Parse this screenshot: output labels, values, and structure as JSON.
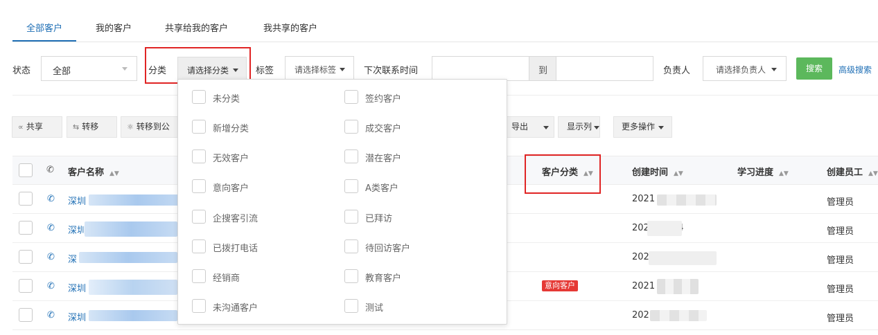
{
  "tabs": [
    "全部客户",
    "我的客户",
    "共享给我的客户",
    "我共享的客户"
  ],
  "filters": {
    "status_label": "状态",
    "status_value": "全部",
    "category_label": "分类",
    "category_placeholder": "请选择分类",
    "tag_label": "标签",
    "tag_placeholder": "请选择标签",
    "next_contact_label": "下次联系时间",
    "to_label": "到",
    "owner_label": "负责人",
    "owner_placeholder": "请选择负责人",
    "search_button": "搜索",
    "advanced_search": "高级搜索"
  },
  "actions": {
    "share": "共享",
    "transfer": "转移",
    "transfer_public": "转移到公",
    "export": "导出",
    "show_columns": "显示列",
    "more_actions": "更多操作"
  },
  "table": {
    "headers": {
      "name": "客户名称",
      "category": "客户分类",
      "created_time": "创建时间",
      "progress": "学习进度",
      "creator": "创建员工"
    },
    "rows": [
      {
        "name": "深圳",
        "time": "2021",
        "creator": "管理员",
        "badge": ""
      },
      {
        "name": "深圳",
        "time": "2021      15 04",
        "creator": "管理员",
        "badge": ""
      },
      {
        "name": "深",
        "time": "202",
        "creator": "管理员",
        "badge": ""
      },
      {
        "name": "深圳",
        "time": "2021        04",
        "creator": "管理员",
        "badge": "意向客户"
      },
      {
        "name": "深圳",
        "time": "202        4",
        "creator": "管理员",
        "badge": ""
      }
    ]
  },
  "dropdown": {
    "col1": [
      "未分类",
      "新增分类",
      "无效客户",
      "意向客户",
      "企搜客引流",
      "已拨打电话",
      "经销商",
      "未沟通客户"
    ],
    "col2": [
      "签约客户",
      "成交客户",
      "潜在客户",
      "A类客户",
      "已拜访",
      "待回访客户",
      "教育客户",
      "测试"
    ]
  },
  "colors": {
    "accent": "#1f6fb5",
    "search_green": "#5cb85c",
    "highlight_red": "#e02424",
    "badge_red": "#e53935"
  }
}
